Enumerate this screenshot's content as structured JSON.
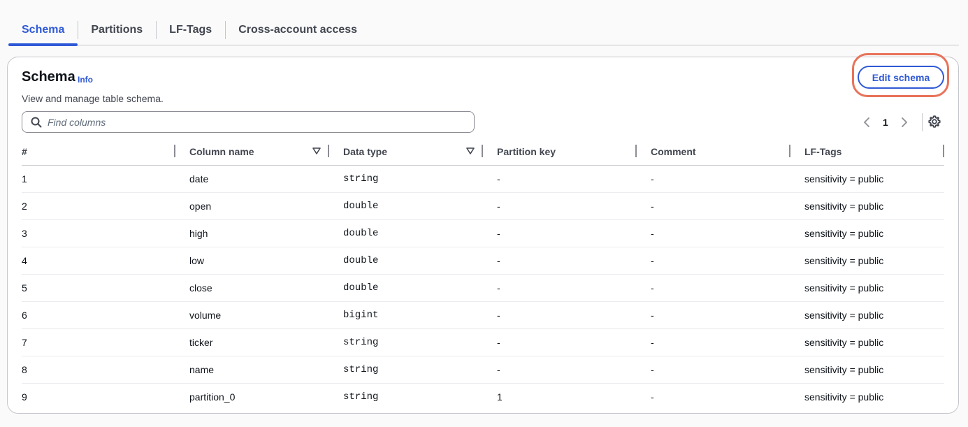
{
  "tabs": [
    {
      "label": "Schema",
      "active": true
    },
    {
      "label": "Partitions",
      "active": false
    },
    {
      "label": "LF-Tags",
      "active": false
    },
    {
      "label": "Cross-account access",
      "active": false
    }
  ],
  "panel": {
    "title": "Schema",
    "info_label": "Info",
    "description": "View and manage table schema.",
    "edit_button_label": "Edit schema",
    "highlight_color": "#e8735a"
  },
  "search": {
    "placeholder": "Find columns",
    "value": ""
  },
  "pagination": {
    "current_page": "1"
  },
  "table": {
    "headers": [
      "#",
      "Column name",
      "Data type",
      "Partition key",
      "Comment",
      "LF-Tags"
    ],
    "rows": [
      [
        "1",
        "date",
        "string",
        "-",
        "-",
        "sensitivity = public"
      ],
      [
        "2",
        "open",
        "double",
        "-",
        "-",
        "sensitivity = public"
      ],
      [
        "3",
        "high",
        "double",
        "-",
        "-",
        "sensitivity = public"
      ],
      [
        "4",
        "low",
        "double",
        "-",
        "-",
        "sensitivity = public"
      ],
      [
        "5",
        "close",
        "double",
        "-",
        "-",
        "sensitivity = public"
      ],
      [
        "6",
        "volume",
        "bigint",
        "-",
        "-",
        "sensitivity = public"
      ],
      [
        "7",
        "ticker",
        "string",
        "-",
        "-",
        "sensitivity = public"
      ],
      [
        "8",
        "name",
        "string",
        "-",
        "-",
        "sensitivity = public"
      ],
      [
        "9",
        "partition_0",
        "string",
        "1",
        "-",
        "sensitivity = public"
      ]
    ]
  },
  "colors": {
    "accent": "#2f59d6",
    "border": "#c6c6cd",
    "text": "#0f141a"
  }
}
